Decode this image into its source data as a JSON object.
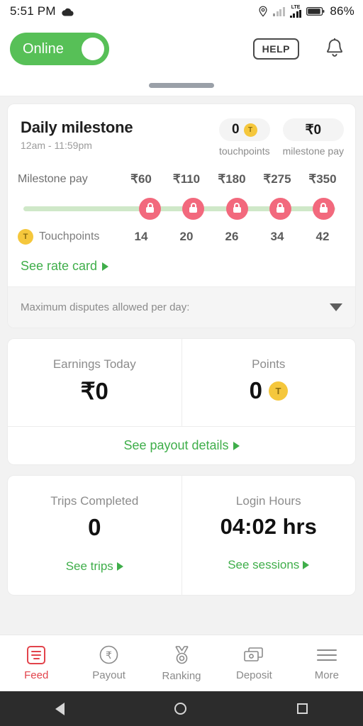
{
  "status_bar": {
    "time": "5:51 PM",
    "network_type": "LTE",
    "battery_percent": "86%",
    "icons": [
      "cloud-icon",
      "location-pin-icon",
      "signal-weak-icon",
      "signal-strong-icon",
      "battery-icon"
    ]
  },
  "header": {
    "toggle_label": "Online",
    "toggle_state": "on",
    "help_label": "HELP",
    "notification_icon": "bell-icon"
  },
  "milestone": {
    "title": "Daily milestone",
    "time_range": "12am - 11:59pm",
    "touchpoints_value": "0",
    "touchpoints_caption": "touchpoints",
    "coin_letter": "T",
    "milestone_pay_value": "₹0",
    "milestone_pay_caption": "milestone pay",
    "pay_row_label": "Milestone pay",
    "touchpoints_row_label": "Touchpoints",
    "pay_tiers": [
      "₹60",
      "₹110",
      "₹180",
      "₹275",
      "₹350"
    ],
    "touchpoint_tiers": [
      "14",
      "20",
      "26",
      "34",
      "42"
    ],
    "tier_states": [
      "locked",
      "locked",
      "locked",
      "locked",
      "locked"
    ],
    "rate_card_link": "See rate card",
    "disputes_label": "Maximum disputes allowed per day:"
  },
  "earnings_card": {
    "earnings_label": "Earnings Today",
    "earnings_value": "₹0",
    "points_label": "Points",
    "points_value": "0",
    "points_coin_letter": "T",
    "payout_link": "See payout details"
  },
  "trips_card": {
    "trips_label": "Trips Completed",
    "trips_value": "0",
    "trips_link": "See trips",
    "hours_label": "Login Hours",
    "hours_value": "04:02 hrs",
    "sessions_link": "See sessions"
  },
  "bottom_nav": {
    "items": [
      {
        "label": "Feed",
        "icon": "feed-icon",
        "active": true
      },
      {
        "label": "Payout",
        "icon": "rupee-circle-icon",
        "active": false
      },
      {
        "label": "Ranking",
        "icon": "medal-icon",
        "active": false
      },
      {
        "label": "Deposit",
        "icon": "cash-stack-icon",
        "active": false
      },
      {
        "label": "More",
        "icon": "hamburger-icon",
        "active": false
      }
    ]
  },
  "android_nav": {
    "back": "back-triangle-icon",
    "home": "home-circle-icon",
    "recents": "recents-square-icon"
  },
  "colors": {
    "online_green": "#57c057",
    "link_green": "#3fae4a",
    "track_green": "#cfe8c8",
    "locked_pink": "#f2697d",
    "coin_yellow": "#f5c73c",
    "active_nav_red": "#e2434b"
  }
}
